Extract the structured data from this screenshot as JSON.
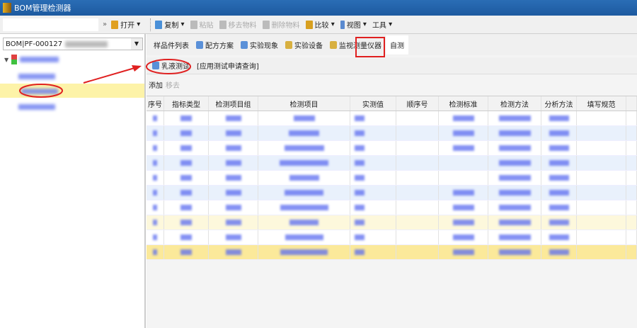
{
  "window": {
    "title": "BOM管理检测器"
  },
  "toolbar": {
    "open": "打开",
    "copy": "复制",
    "paste": "粘贴",
    "move_material": "移去物料",
    "delete_material": "删除物料",
    "compare": "比较",
    "view": "视图",
    "tools": "工具"
  },
  "left": {
    "bom_code": "BOM|PF-000127"
  },
  "tabs": [
    "样品件列表",
    "配方方案",
    "实验现象",
    "实验设备",
    "监视测量仪器",
    "自测"
  ],
  "subtabs": {
    "emulsion_test": "乳液测试",
    "apply_query": "[应用测试申请查询]"
  },
  "actions": {
    "add": "添加",
    "remove": "移去"
  },
  "table": {
    "columns": [
      "序号",
      "指标类型",
      "检测项目组",
      "检测项目",
      "实测值",
      "顺序号",
      "检测标准",
      "检测方法",
      "分析方法",
      "填写规范"
    ],
    "rows": [
      {
        "state": "normal",
        "has_standard": true
      },
      {
        "state": "alt",
        "has_standard": true
      },
      {
        "state": "normal",
        "has_standard": true
      },
      {
        "state": "alt",
        "has_standard": false
      },
      {
        "state": "normal",
        "has_standard": false
      },
      {
        "state": "alt",
        "has_standard": true
      },
      {
        "state": "normal",
        "has_standard": true
      },
      {
        "state": "hl",
        "has_standard": true
      },
      {
        "state": "normal",
        "has_standard": true
      },
      {
        "state": "sel",
        "has_standard": true
      }
    ]
  },
  "colors": {
    "title_bar": "#1d5aa0",
    "annotation": "#e02020",
    "selected_row": "#fbe99a"
  }
}
